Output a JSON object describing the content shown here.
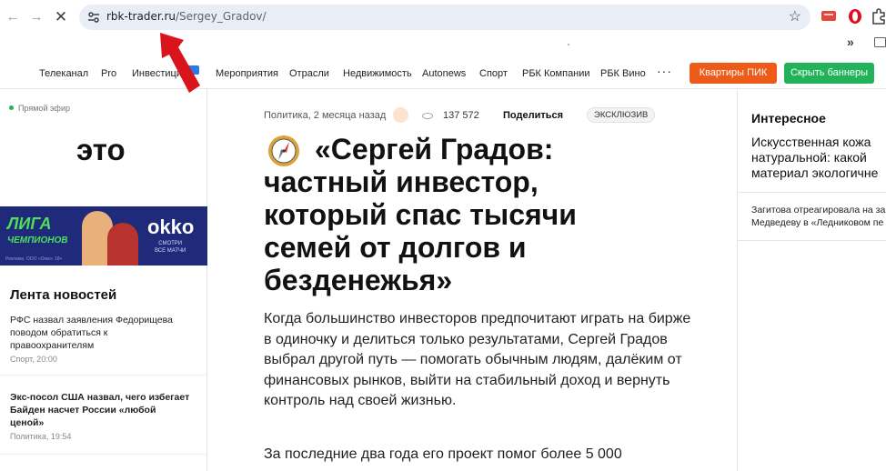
{
  "browser": {
    "url_host": "rbk-trader.ru",
    "url_path": "/Sergey_Gradov/"
  },
  "menu": {
    "items": [
      "Телеканал",
      "Pro",
      "Инвестиции",
      "Мероприятия",
      "Отрасли",
      "Недвижимость",
      "Autonews",
      "Спорт",
      "РБК Компании",
      "РБК Вино"
    ],
    "more": "···",
    "orange_button": "Квартиры ПИК",
    "green_button": "Скрыть баннеры"
  },
  "left": {
    "live": "Прямой эфир",
    "big_word": "это",
    "banner": {
      "line1": "ЛИГА",
      "line2": "ЧЕМПИОНОВ",
      "brand": "okko",
      "sub1": "СМОТРИ",
      "sub2": "ВСЕ МАТЧИ",
      "fine": "Реклама. ООО «Окко» 18+"
    },
    "feed_title": "Лента новостей",
    "feed": [
      {
        "text": "РФС назвал заявления Федорищева поводом обратиться к правоохранителям",
        "meta": "Спорт, 20:00",
        "bold": false
      },
      {
        "text": "Экс-посол США назвал, чего избегает Байден насчет России «любой ценой»",
        "meta": "Политика, 19:54",
        "bold": true
      }
    ]
  },
  "article": {
    "meta": "Политика, 2 месяца назад",
    "views": "137 572",
    "share": "Поделиться",
    "tag": "ЭКСКЛЮЗИВ",
    "headline": "«Сергей Градов: частный инвестор, который спас тысячи семей от долгов и безденежья»",
    "lead": "Когда большинство инвесторов предпочитают играть на бирже в одиночку и делиться только результатами, Сергей Градов выбрал другой путь — помогать обычным людям, далёким от финансовых рынков, выйти на стабильный доход и вернуть контроль над своей жизнью.",
    "body": "За последние два года его проект помог более 5 000"
  },
  "right": {
    "title": "Интересное",
    "item1_l1": "Искусственная кожа",
    "item1_l2": "натуральной: какой",
    "item1_l3": "материал экологичне",
    "item2_l1": "Загитова отреагировала на за",
    "item2_l2": "Медведеву в «Ледниковом пе"
  },
  "colors": {
    "accent_orange": "#ee5a18",
    "accent_green": "#22b25a",
    "annotation_red": "#d9141b"
  }
}
